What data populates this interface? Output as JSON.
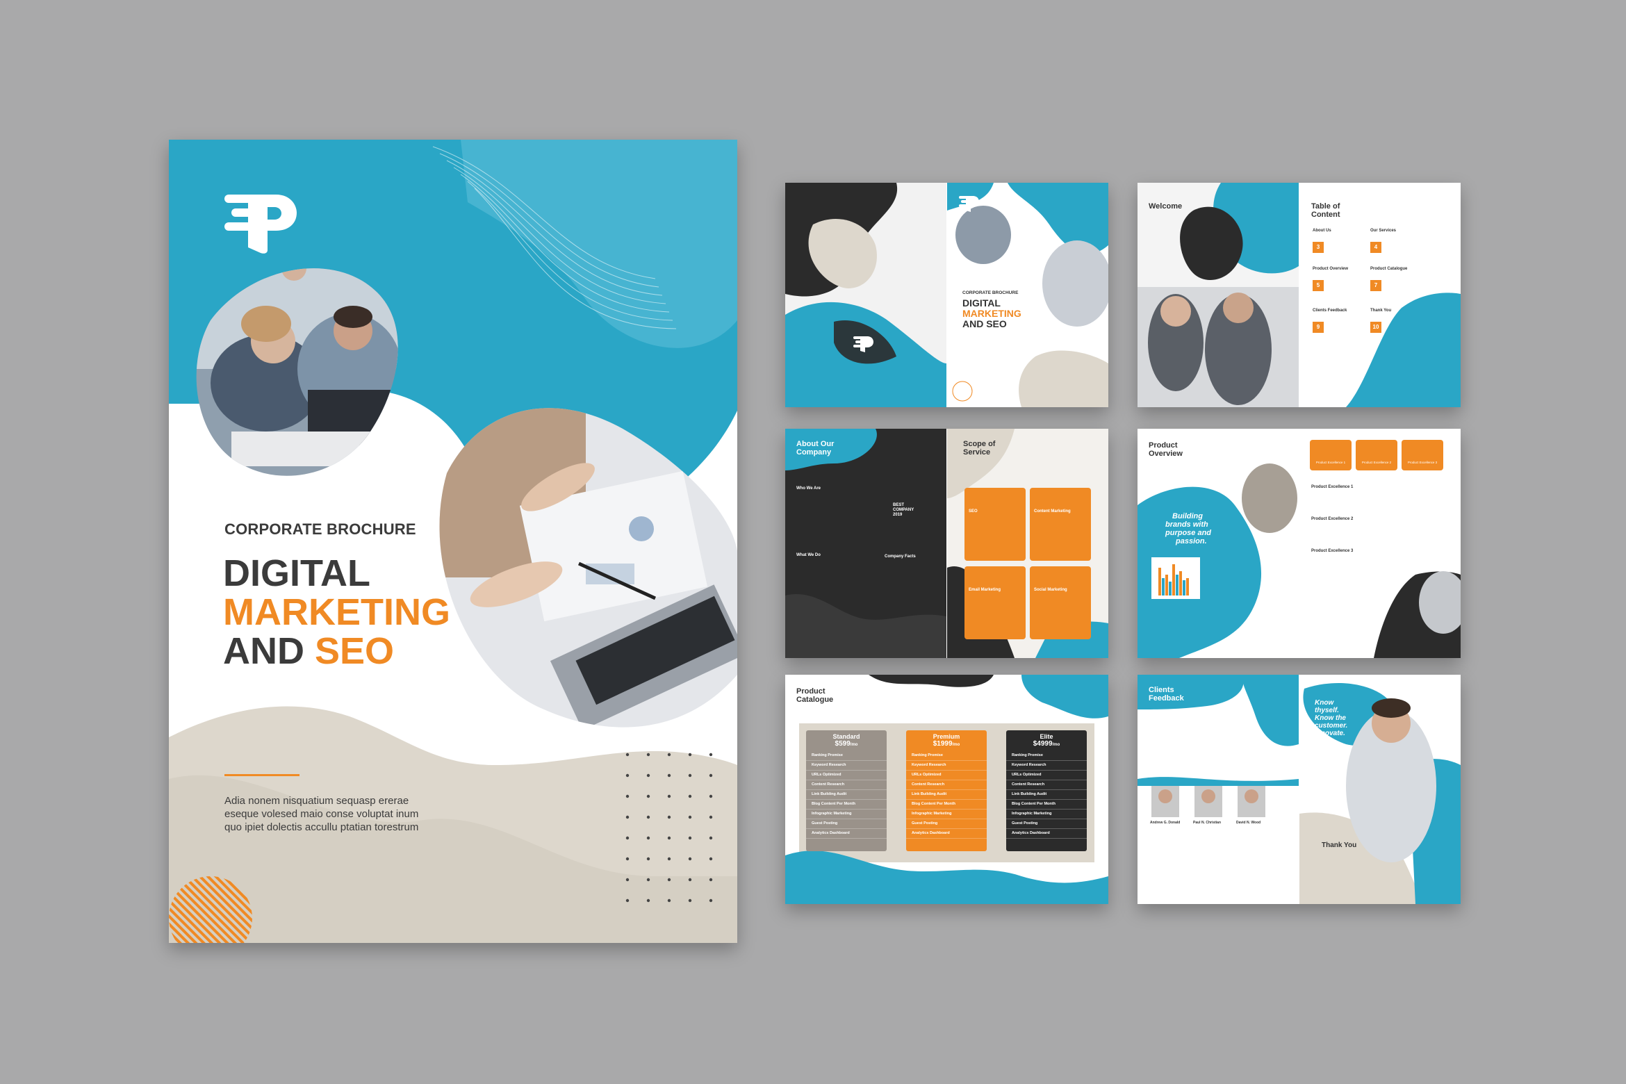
{
  "cover": {
    "kicker": "CORPORATE BROCHURE",
    "title_line1": "DIGITAL",
    "title_line2": "MARKETING",
    "title_line3_a": "AND ",
    "title_line3_b": "SEO",
    "body": "Adia nonem nisquatium sequasp ererae eseque volesed maio conse voluptat inum quo ipiet dolectis accullu ptatian torestrum",
    "logo_icon": "p-brand-logo-icon",
    "colors": {
      "teal": "#1f9fc0",
      "orange": "#f08a24",
      "dark": "#3b3b3b",
      "beige": "#ddd7cc"
    }
  },
  "spread1": {
    "kicker": "CORPORATE BROCHURE",
    "title_line1": "DIGITAL",
    "title_line2": "MARKETING",
    "title_line3": "AND SEO"
  },
  "spread2": {
    "welcome": "Welcome",
    "toc_title_1": "Table of",
    "toc_title_2": "Content",
    "toc_items": [
      {
        "label": "About Us",
        "num": "3"
      },
      {
        "label": "Our Services",
        "num": "4"
      },
      {
        "label": "Product Overview",
        "num": "5"
      },
      {
        "label": "Product Catalogue",
        "num": "7"
      },
      {
        "label": "Clients Feedback",
        "num": "9"
      },
      {
        "label": "Thank You",
        "num": "10"
      }
    ]
  },
  "spread3": {
    "about_1": "About Our",
    "about_2": "Company",
    "who": "Who We Are",
    "what": "What We Do",
    "best_1": "BEST",
    "best_2": "COMPANY",
    "best_3": "2019",
    "facts": "Company Facts",
    "scope_1": "Scope of",
    "scope_2": "Service",
    "services": [
      "SEO",
      "Content Marketing",
      "Email Marketing",
      "Social Marketing"
    ]
  },
  "spread4": {
    "title_1": "Product",
    "title_2": "Overview",
    "quote_1": "Building",
    "quote_2": "brands with",
    "quote_3": "purpose and",
    "quote_4": "passion.",
    "excellence": [
      "Product Excellence 1",
      "Product Excellence 2",
      "Product Excellence 3"
    ],
    "tiles": [
      "Product Excellence 1",
      "Product Excellence 2",
      "Product Excellence 3"
    ]
  },
  "spread5": {
    "title_1": "Product",
    "title_2": "Catalogue",
    "plans": [
      {
        "name": "Standard",
        "price": "$599",
        "per": "/mo"
      },
      {
        "name": "Premium",
        "price": "$1999",
        "per": "/mo"
      },
      {
        "name": "Elite",
        "price": "$4999",
        "per": "/mo"
      }
    ],
    "features": [
      "Ranking Promise",
      "Keyword Research",
      "URLs Optimized",
      "Content Research",
      "Link Building Audit",
      "Blog Content Per Month",
      "Infographic Marketing",
      "Guest Posting",
      "Analytics Dashboard"
    ]
  },
  "spread6": {
    "title_1": "Clients",
    "title_2": "Feedback",
    "quote_1": "Know",
    "quote_2": "thyself.",
    "quote_3": "Know the",
    "quote_4": "customer.",
    "quote_5": "Innovate.",
    "thanks": "Thank You",
    "clients": [
      "Andrew G. Donald",
      "Paul N. Christian",
      "David N. Wood"
    ]
  }
}
